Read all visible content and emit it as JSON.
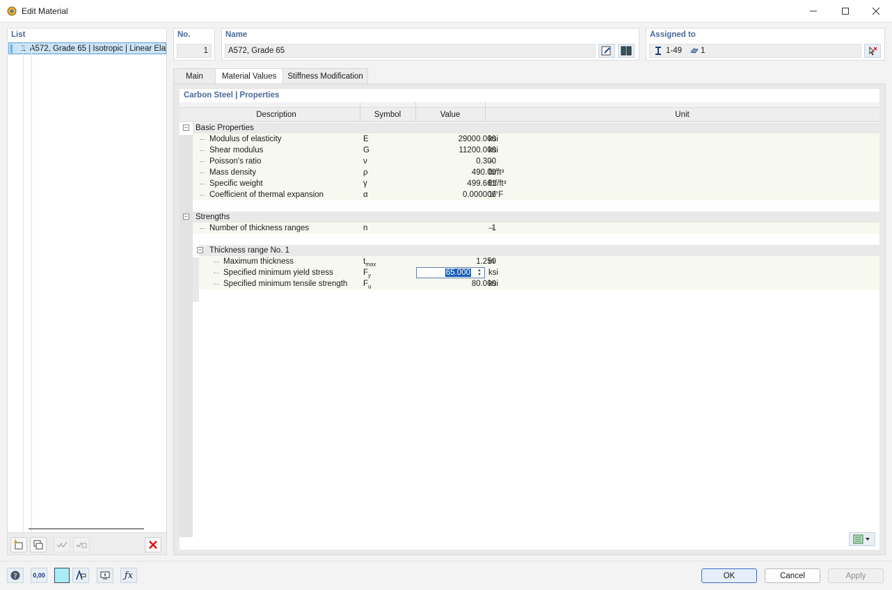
{
  "window": {
    "title": "Edit Material"
  },
  "list": {
    "heading": "List",
    "items": [
      {
        "number": "1",
        "label": "A572, Grade 65 | Isotropic | Linear Ela",
        "color": "#87cefa"
      }
    ]
  },
  "number_panel": {
    "heading": "No.",
    "value": "1"
  },
  "name_panel": {
    "heading": "Name",
    "value": "A572, Grade 65"
  },
  "assigned_panel": {
    "heading": "Assigned to",
    "members": "1-49",
    "surfaces": "1"
  },
  "tabs": [
    {
      "label": "Main"
    },
    {
      "label": "Material Values"
    },
    {
      "label": "Stiffness Modification"
    }
  ],
  "active_tab": "Material Values",
  "section_title": "Carbon Steel | Properties",
  "table": {
    "headers": {
      "description": "Description",
      "symbol": "Symbol",
      "value": "Value",
      "unit": "Unit"
    },
    "basic": {
      "title": "Basic Properties",
      "rows": [
        {
          "description": "Modulus of elasticity",
          "symbol": "E",
          "value": "29000.000",
          "unit": "ksi"
        },
        {
          "description": "Shear modulus",
          "symbol": "G",
          "value": "11200.000",
          "unit": "ksi"
        },
        {
          "description": "Poisson's ratio",
          "symbol": "ν",
          "value": "0.300",
          "unit": "--"
        },
        {
          "description": "Mass density",
          "symbol": "ρ",
          "value": "490.00",
          "unit": "lb/ft³"
        },
        {
          "description": "Specific weight",
          "symbol": "γ",
          "value": "499.661",
          "unit": "lbf/ft³"
        },
        {
          "description": "Coefficient of thermal expansion",
          "symbol": "α",
          "value": "0.000006",
          "unit": "1/°F"
        }
      ]
    },
    "strengths": {
      "title": "Strengths",
      "rows": [
        {
          "description": "Number of thickness ranges",
          "symbol": "n",
          "value": "1",
          "unit": "--"
        }
      ]
    },
    "thickness_range": {
      "title": "Thickness range No. 1",
      "rows": [
        {
          "description": "Maximum thickness",
          "symbol_main": "t",
          "symbol_sub": "max",
          "value": "1.250",
          "unit": "in"
        },
        {
          "description": "Specified minimum yield stress",
          "symbol_main": "F",
          "symbol_sub": "y",
          "value": "65.000",
          "unit": "ksi"
        },
        {
          "description": "Specified minimum tensile strength",
          "symbol_main": "F",
          "symbol_sub": "u",
          "value": "80.000",
          "unit": "ksi"
        }
      ]
    }
  },
  "buttons": {
    "ok": "OK",
    "cancel": "Cancel",
    "apply": "Apply"
  },
  "bottom_icons": [
    "help-icon",
    "units-icon",
    "color-icon",
    "display-icon",
    "info-icon",
    "formula-icon"
  ],
  "units_icon_text": "0,00",
  "colors": {
    "accent": "#4a6a9a",
    "selection": "#1a5fb4",
    "ok_border": "#3c6fbf",
    "delete": "#e01010"
  }
}
